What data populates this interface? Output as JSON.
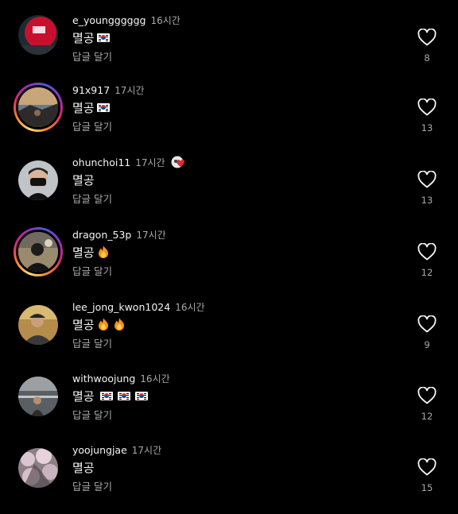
{
  "reply_label": "답글 달기",
  "colors": {
    "background": "#000000",
    "text": "#f5f5f5",
    "muted": "#a8a8a8"
  },
  "comments": [
    {
      "username": "e_youngggggg",
      "time": "16시간",
      "text": "멸공",
      "emojis": [
        "flag-kr-icon"
      ],
      "likes": "8",
      "story_ring": false
    },
    {
      "username": "91x917",
      "time": "17시간",
      "text": "멸공",
      "emojis": [
        "flag-kr-icon"
      ],
      "likes": "13",
      "story_ring": true
    },
    {
      "username": "ohunchoi11",
      "time": "17시간",
      "text": "멸공",
      "emojis": [],
      "likes": "13",
      "story_ring": false,
      "badge": "heart-sticker-icon"
    },
    {
      "username": "dragon_53p",
      "time": "17시간",
      "text": "멸공",
      "emojis": [
        "fire-icon"
      ],
      "likes": "12",
      "story_ring": true
    },
    {
      "username": "lee_jong_kwon1024",
      "time": "16시간",
      "text": "멸공",
      "emojis": [
        "fire-icon",
        "fire-icon"
      ],
      "likes": "9",
      "story_ring": false
    },
    {
      "username": "withwoojung",
      "time": "16시간",
      "text": "멸공 ",
      "emojis": [
        "flag-kr-icon",
        "flag-kr-icon",
        "flag-kr-icon"
      ],
      "likes": "12",
      "story_ring": false
    },
    {
      "username": "yoojungjae",
      "time": "17시간",
      "text": "멸공",
      "emojis": [],
      "likes": "15",
      "story_ring": false
    }
  ]
}
